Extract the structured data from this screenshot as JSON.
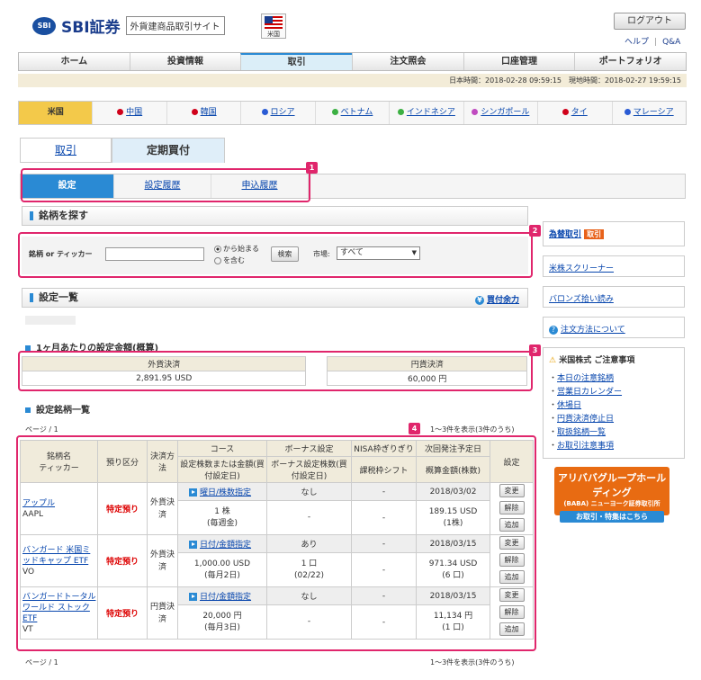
{
  "header": {
    "logo_mark": "SBI",
    "brand": "SBI証券",
    "site_name": "外貨建商品取引サイト",
    "flag_label": "米国",
    "logout": "ログアウト",
    "help": "ヘルプ",
    "qa": "Q&A"
  },
  "main_nav": [
    "ホーム",
    "投資情報",
    "取引",
    "注文照会",
    "口座管理",
    "ポートフォリオ"
  ],
  "time_bar": "日本時間：2018-02-28 09:59:15　現地時間：2018-02-27 19:59:15",
  "markets": [
    {
      "label": "米国",
      "color": "#f3c94a"
    },
    {
      "label": "中国",
      "color": "#d0021b"
    },
    {
      "label": "韓国",
      "color": "#d0021b"
    },
    {
      "label": "ロシア",
      "color": "#2a5bd4"
    },
    {
      "label": "ベトナム",
      "color": "#3cb043"
    },
    {
      "label": "インドネシア",
      "color": "#3cb043"
    },
    {
      "label": "シンガポール",
      "color": "#c04bc0"
    },
    {
      "label": "タイ",
      "color": "#d0021b"
    },
    {
      "label": "マレーシア",
      "color": "#2a5bd4"
    }
  ],
  "trade_tabs": [
    "取引",
    "定期買付"
  ],
  "sub_tabs": [
    "設定",
    "設定履歴",
    "申込履歴"
  ],
  "badges": [
    "1",
    "2",
    "3",
    "4"
  ],
  "search": {
    "heading": "銘柄を探す",
    "label": "銘柄 or ティッカー",
    "value": "",
    "radio1": "から始まる",
    "radio2": "を含む",
    "button": "検索",
    "market_label": "市場:",
    "market_value": "すべて"
  },
  "settings": {
    "heading": "設定一覧",
    "buying_power": "買付余力",
    "monthly_heading": "1ヶ月あたりの設定金額(概算)",
    "foreign_label": "外貨決済",
    "foreign_value": "2,891.95 USD",
    "yen_label": "円貨決済",
    "yen_value": "60,000 円",
    "list_heading": "設定銘柄一覧",
    "page": "ページ / 1",
    "count": "1～3件を表示(3件のうち)"
  },
  "table": {
    "headers": {
      "name": "銘柄名",
      "ticker": "ティッカー",
      "deposit": "預り区分",
      "settle": "決済方法",
      "course": "コース",
      "course_sub": "設定株数または金額(買付設定日)",
      "bonus": "ボーナス設定",
      "bonus_sub": "ボーナス設定株数(買付設定日)",
      "nisa": "NISA枠ぎりぎり",
      "nisa_sub": "課税枠シフト",
      "next": "次回発注予定日",
      "next_sub": "概算金額(株数)",
      "setting": "設定"
    },
    "rows": [
      {
        "name": "アップル",
        "ticker": "AAPL",
        "deposit": "特定預り",
        "settle": "外貨決済",
        "course_link": "曜日/株数指定",
        "amount": "1 株",
        "amount_note": "(毎週金)",
        "bonus": "なし",
        "bonus_amount": "-",
        "nisa": "-",
        "nisa2": "-",
        "date": "2018/03/02",
        "est": "189.15 USD",
        "est_note": "(1株)"
      },
      {
        "name": "バンガード 米国ミッドキャップ ETF",
        "ticker": "VO",
        "deposit": "特定預り",
        "settle": "外貨決済",
        "course_link": "日付/金額指定",
        "amount": "1,000.00 USD",
        "amount_note": "(毎月2日)",
        "bonus": "あり",
        "bonus_amount": "1 口",
        "bonus_note": "(02/22)",
        "nisa": "-",
        "nisa2": "-",
        "date": "2018/03/15",
        "est": "971.34 USD",
        "est_note": "(6 口)"
      },
      {
        "name": "バンガードトータルワールド ストックETF",
        "ticker": "VT",
        "deposit": "特定預り",
        "settle": "円貨決済",
        "course_link": "日付/金額指定",
        "amount": "20,000 円",
        "amount_note": "(毎月3日)",
        "bonus": "なし",
        "bonus_amount": "-",
        "nisa": "-",
        "nisa2": "-",
        "date": "2018/03/15",
        "est": "11,134 円",
        "est_note": "(1 口)"
      }
    ],
    "btn_change": "変更",
    "btn_cancel": "解除",
    "btn_add": "追加"
  },
  "sidebar": {
    "fx": "為替取引",
    "fx_badge": "取引",
    "screener": "米株スクリーナー",
    "barrons": "バロンズ拾い読み",
    "order_help": "注文方法について",
    "notice_heading": "米国株式 ご注意事項",
    "notices": [
      "本日の注意銘柄",
      "営業日カレンダー",
      "休場日",
      "円貨決済停止日",
      "取扱銘柄一覧",
      "お取引注意事項"
    ],
    "banner_title": "アリババグループホールディング",
    "banner_sub": "(BABA) ニューヨーク証券取引所",
    "banner_btn": "お取引・特集はこちら"
  }
}
